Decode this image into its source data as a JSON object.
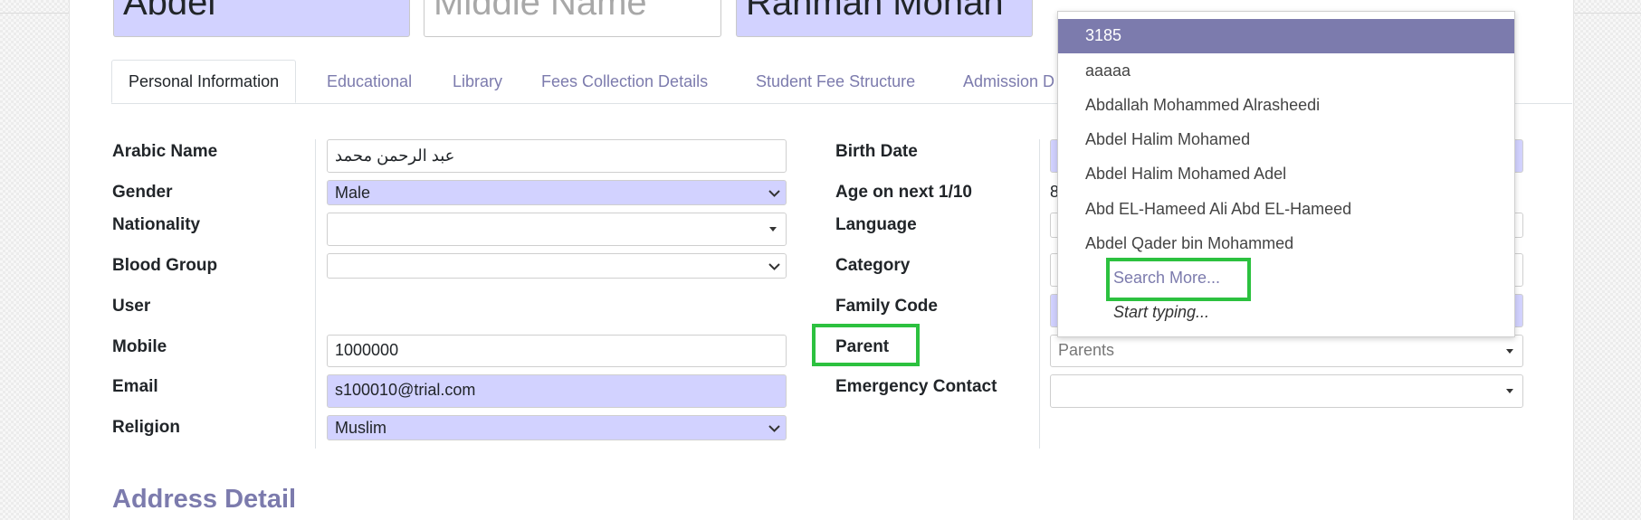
{
  "name": {
    "first": "Abdel",
    "middle_placeholder": "Middle Name",
    "last": "Rahman Mohan"
  },
  "tabs": [
    "Personal Information",
    "Educational",
    "Library",
    "Fees Collection Details",
    "Student Fee Structure",
    "Admission D"
  ],
  "left": {
    "arabic_name_label": "Arabic Name",
    "arabic_name_value": "عبد الرحمن محمد",
    "gender_label": "Gender",
    "gender_value": "Male",
    "nationality_label": "Nationality",
    "blood_group_label": "Blood Group",
    "user_label": "User",
    "mobile_label": "Mobile",
    "mobile_value": "1000000",
    "email_label": "Email",
    "email_value": "s100010@trial.com",
    "religion_label": "Religion",
    "religion_value": "Muslim"
  },
  "right": {
    "birth_date_label": "Birth Date",
    "age_label": "Age on next 1/10",
    "age_value": "8",
    "language_label": "Language",
    "category_label": "Category",
    "family_code_label": "Family Code",
    "parent_label": "Parent",
    "parent_placeholder": "Parents",
    "emergency_label": "Emergency Contact"
  },
  "dropdown": {
    "items": [
      "3185",
      "aaaaa",
      "Abdallah Mohammed Alrasheedi",
      "Abdel Halim Mohamed",
      "Abdel Halim Mohamed Adel",
      "Abd EL-Hameed Ali Abd EL-Hameed",
      "Abdel Qader bin Mohammed"
    ],
    "search_more": "Search More...",
    "start_typing": "Start typing..."
  },
  "section_title": "Address Detail",
  "colors": {
    "accent": "#7c7bad",
    "required_bg": "#d2d2ff",
    "highlight": "#2cc13f"
  }
}
